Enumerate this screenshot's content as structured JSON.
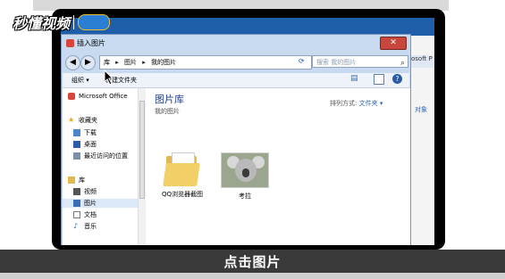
{
  "watermark": {
    "text": "秒懂视频"
  },
  "caption": "点击图片",
  "background_app": {
    "title": "osoft P",
    "label": "对象"
  },
  "dialog": {
    "title": "插入图片",
    "close": "✕",
    "nav": {
      "back": "◀",
      "forward": "▶"
    },
    "breadcrumb": [
      "库",
      "图片",
      "我的图片"
    ],
    "search_placeholder": "搜索 我的图片",
    "toolbar": {
      "organize": "组织 ▾",
      "new_folder": "新建文件夹"
    }
  },
  "sidebar": {
    "items": [
      {
        "label": "Microsoft Office",
        "icon": "office-icon"
      },
      {
        "label": "收藏夹",
        "icon": "star-icon"
      },
      {
        "label": "下载",
        "icon": "download-icon"
      },
      {
        "label": "桌面",
        "icon": "desktop-icon"
      },
      {
        "label": "最近访问的位置",
        "icon": "recent-icon"
      },
      {
        "label": "库",
        "icon": "library-icon"
      },
      {
        "label": "视频",
        "icon": "video-icon"
      },
      {
        "label": "图片",
        "icon": "pictures-icon"
      },
      {
        "label": "文档",
        "icon": "documents-icon"
      },
      {
        "label": "音乐",
        "icon": "music-icon"
      }
    ]
  },
  "content": {
    "title": "图片库",
    "subtitle": "我的图片",
    "arrange_label": "排列方式:",
    "arrange_value": "文件夹 ▾",
    "files": [
      {
        "name": "QQ浏览器截图",
        "type": "folder"
      },
      {
        "name": "考拉",
        "type": "image"
      }
    ]
  }
}
